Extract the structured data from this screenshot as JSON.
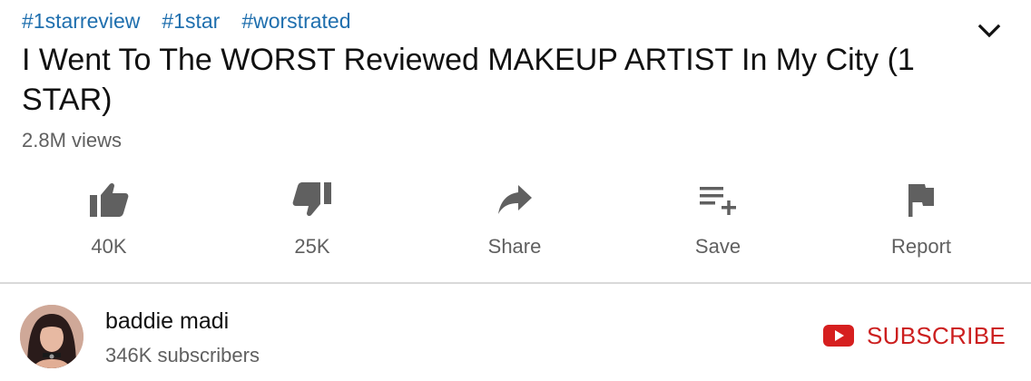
{
  "hashtags": [
    "#1starreview",
    "#1star",
    "#worstrated"
  ],
  "video": {
    "title": "I Went To The WORST Reviewed MAKEUP ARTIST In My City (1 STAR)",
    "views": "2.8M views"
  },
  "actions": {
    "like": {
      "label": "40K",
      "icon": "thumbs-up-icon"
    },
    "dislike": {
      "label": "25K",
      "icon": "thumbs-down-icon"
    },
    "share": {
      "label": "Share",
      "icon": "share-arrow-icon"
    },
    "save": {
      "label": "Save",
      "icon": "playlist-add-icon"
    },
    "report": {
      "label": "Report",
      "icon": "flag-icon"
    }
  },
  "channel": {
    "name": "baddie madi",
    "subscribers": "346K subscribers"
  },
  "subscribe": {
    "label": "SUBSCRIBE",
    "icon": "youtube-play-icon"
  },
  "colors": {
    "hashtag": "#1f6fae",
    "title": "#111111",
    "secondary_text": "#606060",
    "icon_gray": "#606060",
    "subscribe_red": "#cc1f1f",
    "divider": "#d9d9d9"
  }
}
